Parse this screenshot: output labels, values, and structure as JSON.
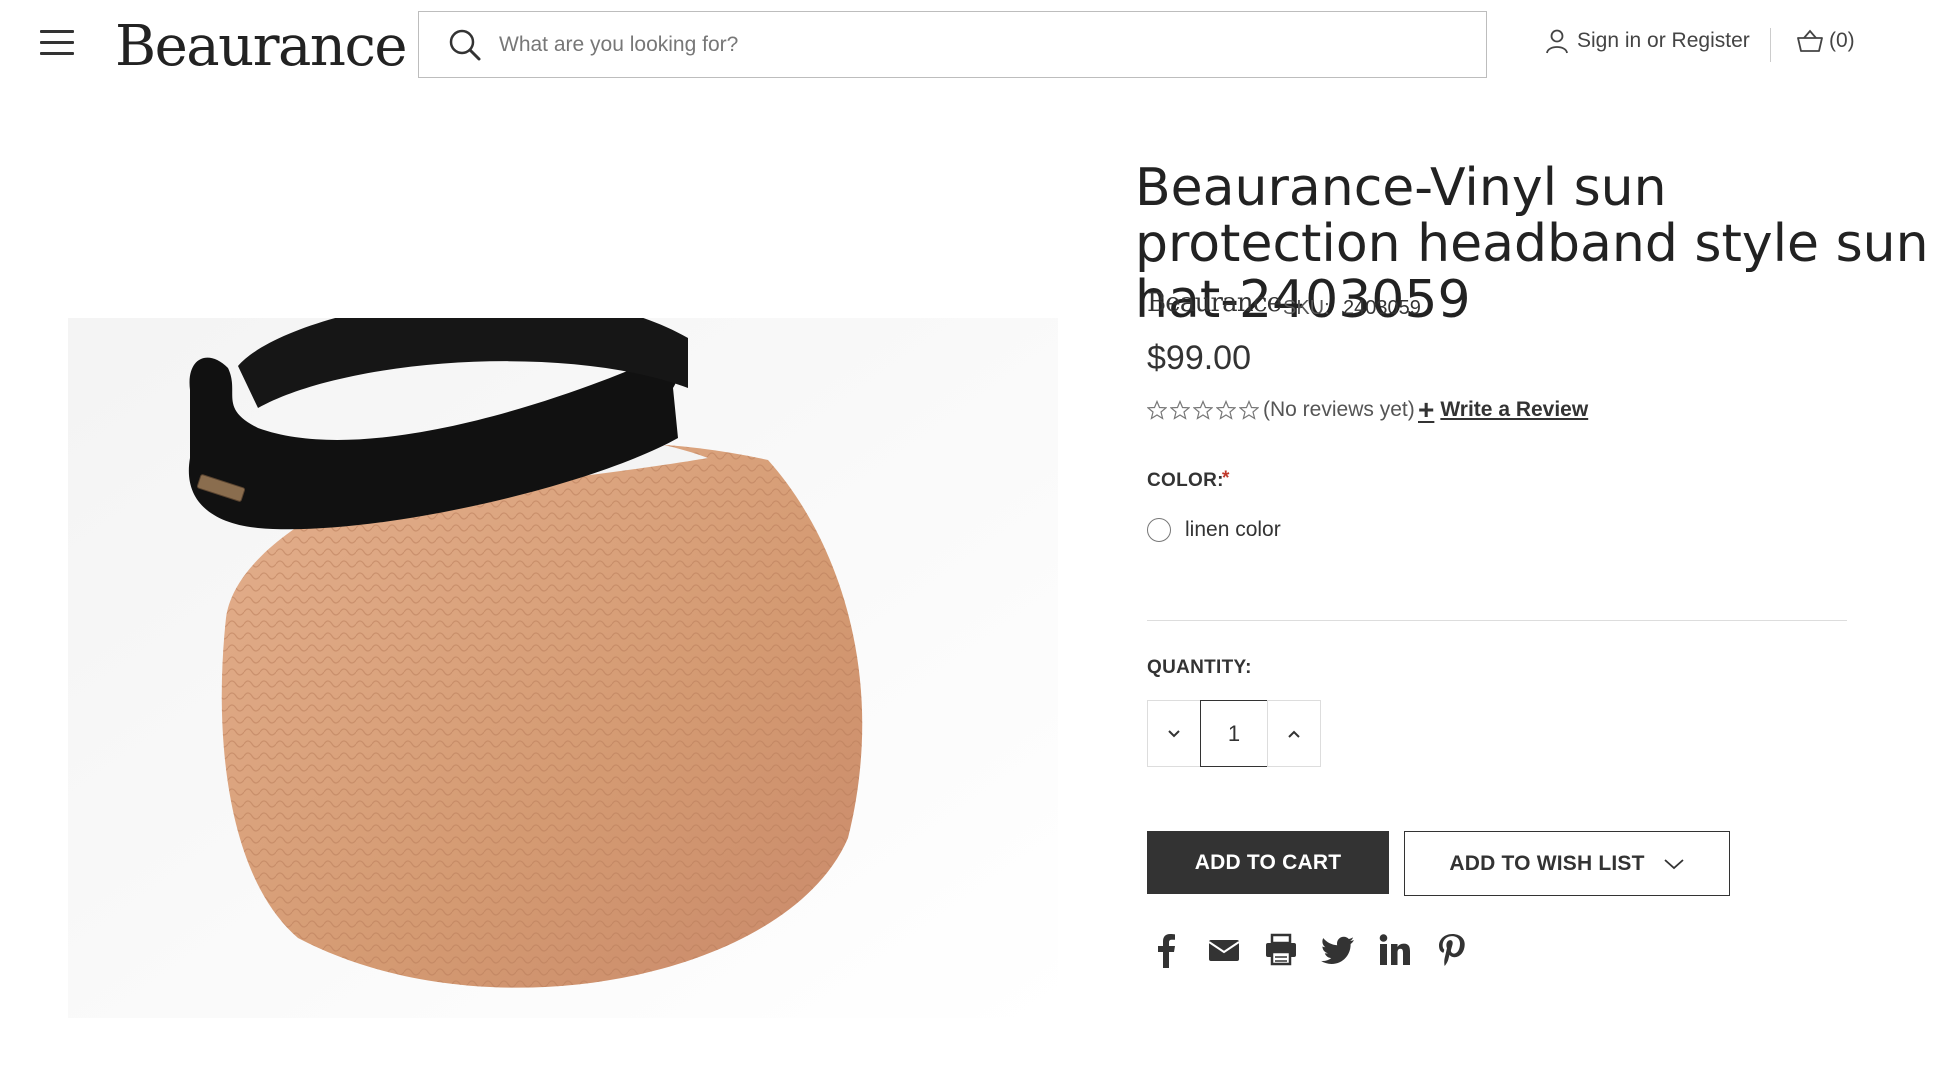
{
  "header": {
    "logo": "Beaurance",
    "search_placeholder": "What are you looking for?",
    "account_text": "Sign in or Register",
    "cart_count": "(0)"
  },
  "product": {
    "title": "Beaurance-Vinyl sun protection headband style sun hat-2403059",
    "brand": "Beaurance",
    "sku_label": "SKU:",
    "sku": "2403059",
    "price": "$99.00",
    "reviews_text": "(No reviews yet)",
    "write_review": "Write a Review",
    "color_label": "COLOR:",
    "required_mark": "*",
    "color_option": "linen color",
    "quantity_label": "QUANTITY:",
    "quantity": "1",
    "add_to_cart": "ADD TO CART",
    "add_to_wishlist": "ADD TO WISH LIST",
    "rating": 0,
    "rating_max": 5,
    "share_icons": [
      "facebook-icon",
      "email-icon",
      "print-icon",
      "twitter-icon",
      "linkedin-icon",
      "pinterest-icon"
    ]
  },
  "colors": {
    "text": "#333333",
    "button_dark": "#333333",
    "required": "#c0392b",
    "hat_straw": "#d8a07a",
    "hat_band": "#111111"
  }
}
